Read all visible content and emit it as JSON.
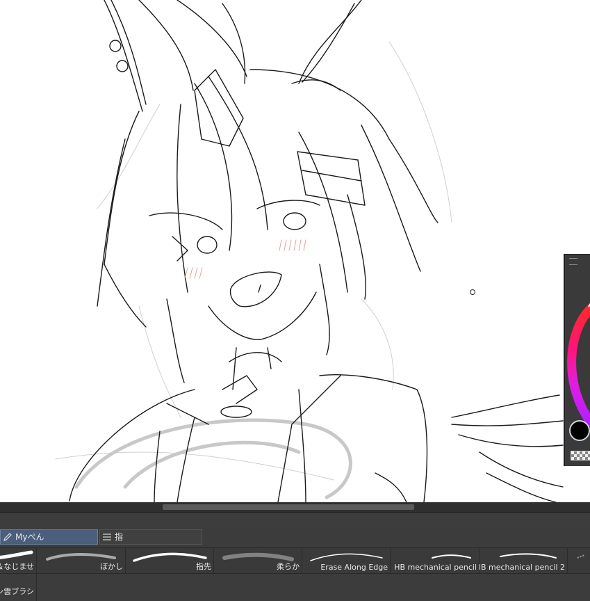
{
  "brush_groups": [
    {
      "label": "Myぺん",
      "icon": "pen-icon",
      "active": true
    },
    {
      "label": "指",
      "icon": "list-icon",
      "active": false
    }
  ],
  "brushes": [
    {
      "label": "＆なじませ"
    },
    {
      "label": "ぼかし"
    },
    {
      "label": "指先"
    },
    {
      "label": "柔らか"
    },
    {
      "label": "Erase Along Edge"
    },
    {
      "label": "HB mechanical pencil"
    },
    {
      "label": "HB mechanical pencil 2"
    }
  ],
  "second_row_brush": {
    "label": "ン雲ブラシ"
  },
  "color_palette": {
    "current_color": "#000000"
  }
}
